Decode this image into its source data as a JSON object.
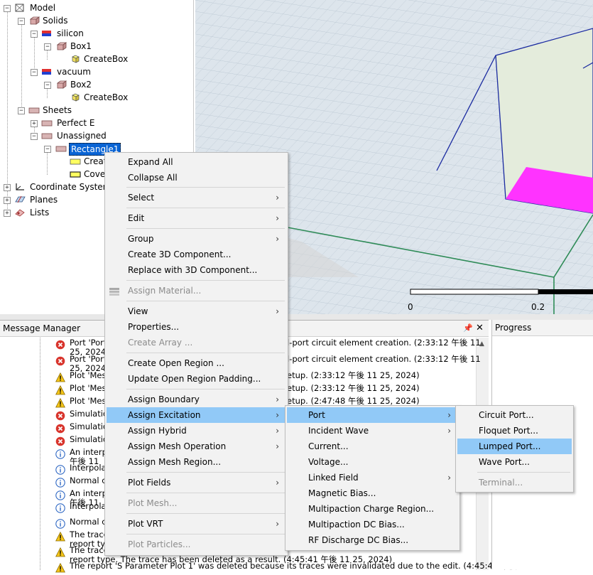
{
  "tree": {
    "model": "Model",
    "solids": "Solids",
    "silicon": "silicon",
    "box1": "Box1",
    "createbox1": "CreateBox",
    "vacuum": "vacuum",
    "box2": "Box2",
    "createbox2": "CreateBox",
    "sheets": "Sheets",
    "perfect_e": "Perfect E",
    "unassigned": "Unassigned",
    "rectangle1": "Rectangle1",
    "create_child": "Create",
    "cover_child": "Cover",
    "coordinate_systems": "Coordinate Systems",
    "planes": "Planes",
    "lists": "Lists"
  },
  "viewport": {
    "scale_zero": "0",
    "scale_mid": "0.2",
    "colors": {
      "background": "#dfe7ee",
      "grid": "#b8c6d2",
      "box_edge": "#1a2aa0",
      "port": "#ff33ff",
      "axis_green": "#2e8b57"
    }
  },
  "message_manager": {
    "title": "Message Manager",
    "messages": [
      {
        "icon": "error",
        "lines": [
          "Port 'Port'",
          "25, 2024)"
        ],
        "tail": "l-port circuit element creation. (2:33:12 午後  11"
      },
      {
        "icon": "error",
        "lines": [
          "Port 'Port'",
          "25, 2024)"
        ],
        "tail": "l-port circuit element creation. (2:33:12 午後  11"
      },
      {
        "icon": "warning",
        "lines": [
          "Plot 'Mesh"
        ],
        "tail": "etup. (2:33:12 午後  11 25, 2024)"
      },
      {
        "icon": "warning",
        "lines": [
          "Plot 'Mesh"
        ],
        "tail": "etup. (2:33:12 午後  11 25, 2024)"
      },
      {
        "icon": "warning",
        "lines": [
          "Plot 'Mesh"
        ],
        "tail": "etup. (2:47:48 午後  11 25, 2024)"
      },
      {
        "icon": "error",
        "lines": [
          "Simulation"
        ]
      },
      {
        "icon": "error",
        "lines": [
          "Simulation"
        ]
      },
      {
        "icon": "error",
        "lines": [
          "Simulation"
        ]
      },
      {
        "icon": "info",
        "lines": [
          "An interpo",
          "午後  11"
        ]
      },
      {
        "icon": "info",
        "lines": [
          "Interpolat"
        ]
      },
      {
        "icon": "info",
        "lines": [
          "Normal co"
        ]
      },
      {
        "icon": "info",
        "lines": [
          "An interpo",
          "午後  11"
        ]
      },
      {
        "icon": "info",
        "lines": [
          "Interpolat"
        ]
      },
      {
        "icon": "info",
        "lines": [
          "Normal co"
        ]
      },
      {
        "icon": "warning",
        "lines": [
          "The trace",
          "report typ"
        ]
      },
      {
        "icon": "warning",
        "lines": [
          "The trace",
          "report type. The trace has been deleted as a result. (4:45:41 午後  11 25, 2024)"
        ]
      },
      {
        "icon": "warning",
        "lines": [
          "The report 'S Parameter Plot 1' was deleted because its traces were invalidated due to the edit. (4:45:41 午後"
        ]
      }
    ]
  },
  "progress": {
    "title": "Progress"
  },
  "context_menu": {
    "items": [
      {
        "label": "Expand All"
      },
      {
        "label": "Collapse All"
      },
      {
        "label": "Select",
        "submenu": true
      },
      {
        "label": "Edit",
        "submenu": true
      },
      {
        "label": "Group",
        "submenu": true
      },
      {
        "label": "Create 3D Component..."
      },
      {
        "label": "Replace with 3D Component..."
      },
      {
        "label": "Assign Material...",
        "disabled": true
      },
      {
        "label": "View",
        "submenu": true
      },
      {
        "label": "Properties..."
      },
      {
        "label": "Create Array ...",
        "disabled": true
      },
      {
        "label": "Create Open Region ..."
      },
      {
        "label": "Update Open Region Padding..."
      },
      {
        "label": "Assign Boundary",
        "submenu": true
      },
      {
        "label": "Assign Excitation",
        "submenu": true,
        "highlighted": true
      },
      {
        "label": "Assign Hybrid",
        "submenu": true
      },
      {
        "label": "Assign Mesh Operation",
        "submenu": true
      },
      {
        "label": "Assign Mesh Region..."
      },
      {
        "label": "Plot Fields",
        "submenu": true
      },
      {
        "label": "Plot Mesh...",
        "disabled": true
      },
      {
        "label": "Plot VRT",
        "submenu": true
      },
      {
        "label": "Plot Particles...",
        "disabled": true
      }
    ]
  },
  "excitation_menu": {
    "items": [
      {
        "label": "Port",
        "submenu": true,
        "highlighted": true
      },
      {
        "label": "Incident Wave",
        "submenu": true
      },
      {
        "label": "Current..."
      },
      {
        "label": "Voltage..."
      },
      {
        "label": "Linked Field",
        "submenu": true
      },
      {
        "label": "Magnetic Bias..."
      },
      {
        "label": "Multipaction Charge Region..."
      },
      {
        "label": "Multipaction DC Bias..."
      },
      {
        "label": "RF Discharge DC Bias..."
      }
    ]
  },
  "port_menu": {
    "items": [
      {
        "label": "Circuit Port..."
      },
      {
        "label": "Floquet Port..."
      },
      {
        "label": "Lumped Port...",
        "highlighted": true
      },
      {
        "label": "Wave Port..."
      },
      {
        "label": "Terminal...",
        "disabled": true
      }
    ]
  }
}
